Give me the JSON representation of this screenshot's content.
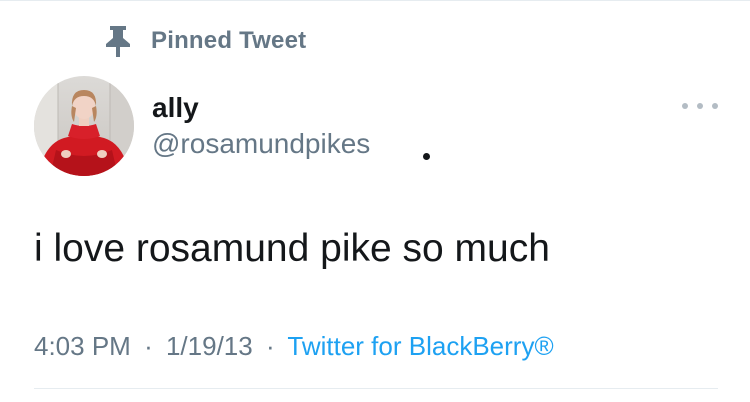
{
  "pinned": {
    "icon": "pin-icon",
    "label": "Pinned Tweet"
  },
  "author": {
    "avatar": "avatar-photo",
    "name": "ally",
    "handle": "@rosamundpikes"
  },
  "menu": {
    "icon": "more-options-icon"
  },
  "tweet": {
    "text": "i love rosamund pike so much"
  },
  "meta": {
    "time": "4:03 PM",
    "separator": "·",
    "date": "1/19/13",
    "source": "Twitter for BlackBerry®"
  },
  "colors": {
    "secondary_text": "#657786",
    "link": "#1da1f2",
    "primary_text": "#14171a"
  }
}
